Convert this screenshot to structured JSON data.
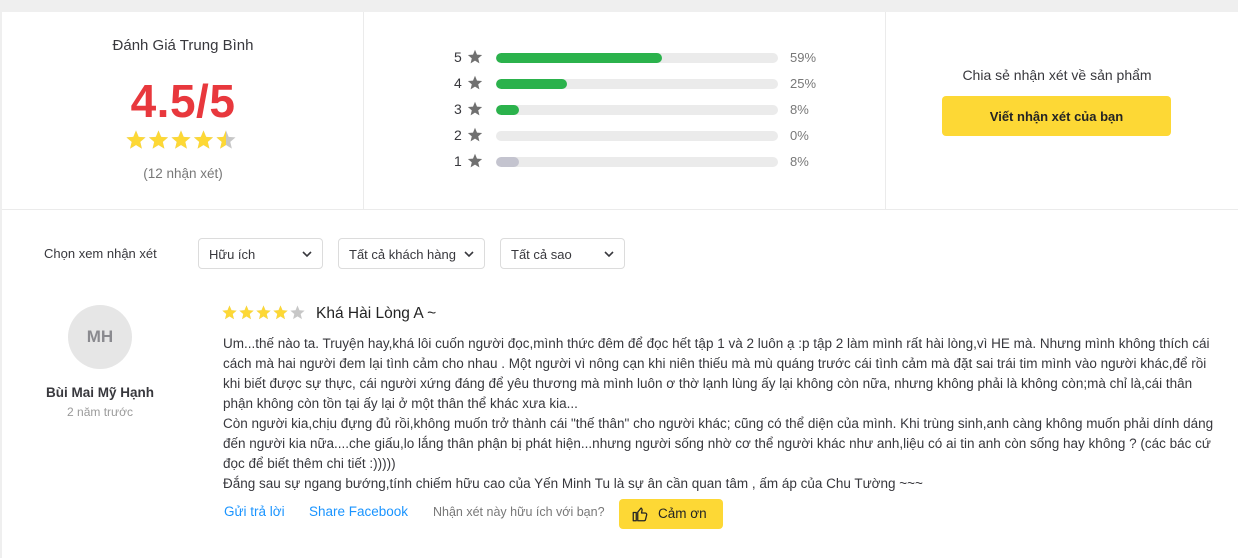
{
  "summary": {
    "title": "Đánh Giá Trung Bình",
    "score": "4.5/5",
    "rating_value": 4.5,
    "count_text": "(12 nhận xét)",
    "colors": {
      "score": "#e8383d",
      "star_filled": "#fdd835",
      "star_empty": "#c7c7c7"
    }
  },
  "distribution": [
    {
      "stars": "5",
      "percent_text": "59%",
      "percent": 59,
      "color": "#2bb24c"
    },
    {
      "stars": "4",
      "percent_text": "25%",
      "percent": 25,
      "color": "#2bb24c"
    },
    {
      "stars": "3",
      "percent_text": "8%",
      "percent": 8,
      "color": "#2bb24c"
    },
    {
      "stars": "2",
      "percent_text": "0%",
      "percent": 0,
      "color": "#2bb24c"
    },
    {
      "stars": "1",
      "percent_text": "8%",
      "percent": 8,
      "color": "#c4c4cf"
    }
  ],
  "share": {
    "text": "Chia sẻ nhận xét về sản phẩm",
    "button_label": "Viết nhận xét của bạn",
    "button_color": "#fdd835"
  },
  "filters": {
    "label": "Chọn xem nhận xét",
    "selects": [
      {
        "value": "Hữu ích"
      },
      {
        "value": "Tất cả khách hàng"
      },
      {
        "value": "Tất cả sao"
      }
    ]
  },
  "review": {
    "avatar_initials": "MH",
    "author": "Bùi Mai Mỹ Hạnh",
    "time": "2 năm trước",
    "rating": 4,
    "title": "Khá Hài Lòng A ~",
    "paragraphs": [
      "Um...thế nào ta. Truyện hay,khá lôi cuốn người đọc,mình thức đêm để đọc hết tập 1 và 2 luôn ạ :p tập 2 làm mình rất hài lòng,vì HE mà. Nhưng mình không thích cái cách mà hai người đem lại tình cảm cho nhau . Một người vì nông cạn khi niên thiếu mà mù quáng trước cái tình cảm mà đặt sai trái tim mình vào người khác,để rồi khi biết được sự thực, cái người xứng đáng để yêu thương mà mình luôn ơ thờ lạnh lùng ấy lại không còn nữa, nhưng không phải là không còn;mà chỉ là,cái thân phận không còn tồn tại ấy lại ở một thân thể khác xưa kia...",
      "Còn người kia,chịu đựng đủ rồi,không muốn trở thành cái \"thế thân\" cho người khác; cũng có thể diện của mình. Khi trùng sinh,anh càng không muốn phải dính dáng đến người kia nữa....che giấu,lo lắng thân phận bị phát hiện...nhưng người sống nhờ cơ thể người khác như anh,liệu có ai tin anh còn sống hay không ? (các bác cứ đọc để biết thêm chi tiết :)))))",
      "Đắng sau sự ngang bướng,tính chiếm hữu cao của Yến Minh Tu là sự ân cần quan tâm , ấm áp của Chu Tường ~~~"
    ],
    "reply_label": "Gửi trả lời",
    "share_facebook_label": "Share Facebook",
    "helpful_question": "Nhận xét này hữu ích với bạn?",
    "thanks_label": "Cảm ơn",
    "link_color": "#1a94ff"
  }
}
